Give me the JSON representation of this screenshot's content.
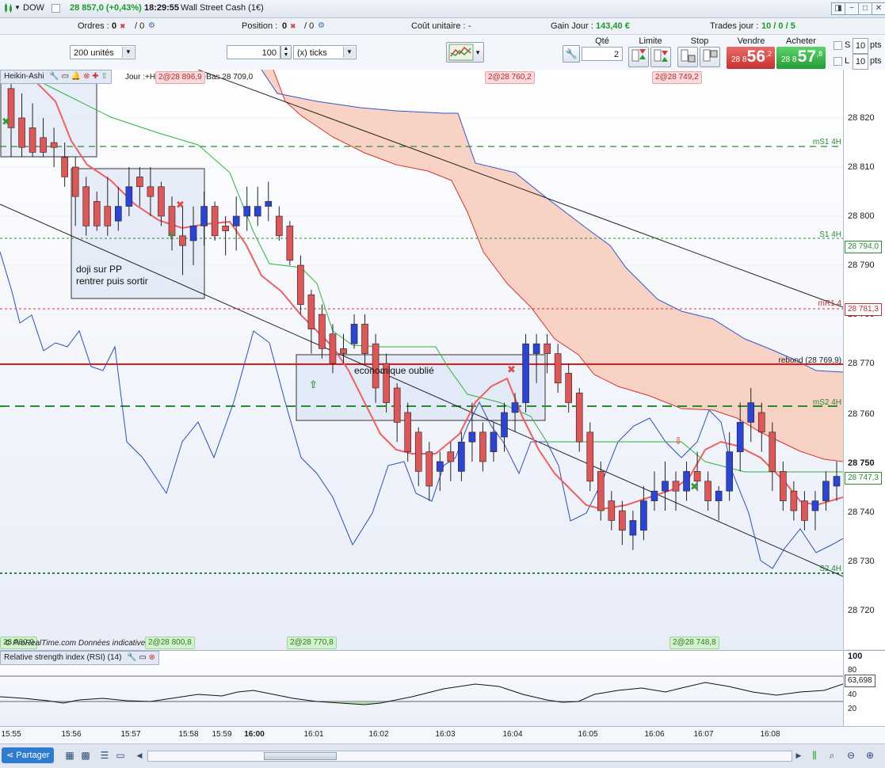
{
  "topbar": {
    "symbol": "DOW",
    "change": "28 857,0 (+0,43%)",
    "time": "18:29:55",
    "instrument": "Wall Street Cash (1€)"
  },
  "infobar": {
    "orders_label": "Ordres :",
    "orders_value": "0",
    "orders_value2": "/ 0",
    "position_label": "Position :",
    "position_value": "0",
    "position_value2": "/ 0",
    "unit_cost_label": "Coût unitaire :",
    "unit_cost_value": "-",
    "day_gain_label": "Gain Jour :",
    "day_gain_value": "143,40 €",
    "day_trades_label": "Trades jour :",
    "day_trades_value": "10 / 0 / 5"
  },
  "orderbar": {
    "units_select": "200 unités",
    "ticks_value": "100",
    "ticks_select": "(x) ticks",
    "qty_label": "Qté",
    "qty_value": "2",
    "limit_label": "Limite",
    "stop_label": "Stop",
    "sell_label": "Vendre",
    "sell_prefix": "28 8",
    "sell_big": "56",
    "sell_sup": ",2",
    "buy_label": "Acheter",
    "buy_prefix": "28 8",
    "buy_big": "57",
    "buy_sup": ",8",
    "s_label": "S",
    "s_pts": "10",
    "l_label": "L",
    "l_pts": "10",
    "pts_label": "pts"
  },
  "chart": {
    "indicator_title": "Heikin-Ashi",
    "legend_text": "Jour :+Haut 28 896,9 +Bas 28 709,0",
    "top_tags": [
      "2@28 896,9",
      "2@28 760,2",
      "2@28 749,2"
    ],
    "bottom_tags": [
      "2@28 800,8",
      "2@28 770,8",
      "2@28 748,8"
    ],
    "left_bottom_tag": "28 830,0",
    "copyright": "© ProRealTime.com  Données indicatives",
    "annotation_doji_line1": "doji sur PP",
    "annotation_doji_line2": "rentrer puis sortir",
    "annotation_eco": "economique oublié",
    "levels": {
      "ms1": "mS1 4H",
      "s1": "S1 4H",
      "mr1": "mR1 4",
      "ms2": "mS2 4H",
      "s2": "S2 4H",
      "rebond": "rebond (28 769,9)"
    },
    "price_axis_labels": [
      "28 820",
      "28 810",
      "28 800",
      "28 790",
      "28 780",
      "28 770",
      "28 760",
      "28 750",
      "28 740",
      "28 730",
      "28 720"
    ],
    "price_tags": {
      "s1_val": "28 794,0",
      "mr1_val": "28 781,3",
      "last_val": "28 747,3"
    }
  },
  "rsi": {
    "title": "Relative strength index (RSI) (14)",
    "axis_labels": [
      "100",
      "80",
      "40",
      "20"
    ],
    "value_tag": "63,698"
  },
  "time_axis": [
    "15:55",
    "15:56",
    "15:57",
    "15:58",
    "15:59",
    "16:00",
    "16:01",
    "16:02",
    "16:03",
    "16:04",
    "16:05",
    "16:06",
    "16:07",
    "16:08"
  ],
  "bottombar": {
    "share_label": "Partager"
  },
  "chart_data": {
    "type": "candlestick",
    "title": "",
    "ylim": [
      28715,
      28830
    ],
    "candles": [
      [
        28826,
        28828,
        28812,
        28818,
        "d"
      ],
      [
        28820,
        28825,
        28812,
        28814,
        "d"
      ],
      [
        28818,
        28823,
        28812,
        28813,
        "d"
      ],
      [
        28816,
        28820,
        28812,
        28813,
        "d"
      ],
      [
        28815,
        28818,
        28810,
        28814,
        "d"
      ],
      [
        28812,
        28815,
        28806,
        28808,
        "d"
      ],
      [
        28810,
        28812,
        28798,
        28804,
        "d"
      ],
      [
        28806,
        28808,
        28796,
        28798,
        "d"
      ],
      [
        28803,
        28805,
        28797,
        28798,
        "d"
      ],
      [
        28802,
        28808,
        28796,
        28798,
        "d"
      ],
      [
        28799,
        28806,
        28797,
        28802,
        "u"
      ],
      [
        28802,
        28810,
        28800,
        28806,
        "u"
      ],
      [
        28808,
        28810,
        28802,
        28806,
        "d"
      ],
      [
        28806,
        28810,
        28800,
        28804,
        "d"
      ],
      [
        28806,
        28807,
        28798,
        28800,
        "d"
      ],
      [
        28802,
        28804,
        28793,
        28796,
        "d"
      ],
      [
        28796,
        28802,
        28788,
        28794,
        "d"
      ],
      [
        28795,
        28802,
        28790,
        28798,
        "u"
      ],
      [
        28798,
        28805,
        28794,
        28802,
        "u"
      ],
      [
        28802,
        28803,
        28795,
        28796,
        "d"
      ],
      [
        28798,
        28800,
        28792,
        28797,
        "d"
      ],
      [
        28798,
        28804,
        28793,
        28800,
        "u"
      ],
      [
        28800,
        28806,
        28797,
        28802,
        "u"
      ],
      [
        28800,
        28806,
        28798,
        28802,
        "u"
      ],
      [
        28802,
        28807,
        28799,
        28803,
        "u"
      ],
      [
        28800,
        28802,
        28795,
        28796,
        "d"
      ],
      [
        28798,
        28799,
        28790,
        28791,
        "d"
      ],
      [
        28790,
        28792,
        28780,
        28782,
        "d"
      ],
      [
        28784,
        28785,
        28772,
        28777,
        "d"
      ],
      [
        28780,
        28782,
        28771,
        28773,
        "d"
      ],
      [
        28776,
        28778,
        28768,
        28770,
        "d"
      ],
      [
        28773,
        28776,
        28770,
        28772,
        "d"
      ],
      [
        28774,
        28780,
        28773,
        28778,
        "u"
      ],
      [
        28778,
        28780,
        28770,
        28772,
        "d"
      ],
      [
        28774,
        28776,
        28762,
        28765,
        "d"
      ],
      [
        28770,
        28772,
        28760,
        28762,
        "d"
      ],
      [
        28765,
        28766,
        28754,
        28758,
        "d"
      ],
      [
        28760,
        28762,
        28750,
        28752,
        "d"
      ],
      [
        28756,
        28757,
        28745,
        28748,
        "d"
      ],
      [
        28752,
        28754,
        28742,
        28745,
        "d"
      ],
      [
        28748,
        28752,
        28744,
        28750,
        "u"
      ],
      [
        28752,
        28754,
        28746,
        28750,
        "d"
      ],
      [
        28748,
        28756,
        28746,
        28754,
        "u"
      ],
      [
        28754,
        28762,
        28750,
        28756,
        "u"
      ],
      [
        28756,
        28758,
        28748,
        28750,
        "d"
      ],
      [
        28752,
        28758,
        28750,
        28756,
        "u"
      ],
      [
        28755,
        28762,
        28752,
        28760,
        "u"
      ],
      [
        28760,
        28764,
        28756,
        28762,
        "u"
      ],
      [
        28762,
        28776,
        28760,
        28774,
        "u"
      ],
      [
        28772,
        28776,
        28766,
        28774,
        "u"
      ],
      [
        28774,
        28776,
        28768,
        28772,
        "d"
      ],
      [
        28772,
        28774,
        28764,
        28766,
        "d"
      ],
      [
        28768,
        28770,
        28760,
        28762,
        "d"
      ],
      [
        28764,
        28765,
        28752,
        28754,
        "d"
      ],
      [
        28756,
        28758,
        28744,
        28746,
        "d"
      ],
      [
        28748,
        28750,
        28738,
        28740,
        "d"
      ],
      [
        28742,
        28744,
        28736,
        28738,
        "d"
      ],
      [
        28740,
        28742,
        28733,
        28736,
        "d"
      ],
      [
        28738,
        28740,
        28732,
        28735,
        "u"
      ],
      [
        28736,
        28745,
        28734,
        28742,
        "u"
      ],
      [
        28742,
        28748,
        28740,
        28744,
        "u"
      ],
      [
        28744,
        28750,
        28740,
        28746,
        "u"
      ],
      [
        28746,
        28748,
        28740,
        28744,
        "d"
      ],
      [
        28744,
        28750,
        28742,
        28748,
        "u"
      ],
      [
        28748,
        28752,
        28744,
        28746,
        "d"
      ],
      [
        28746,
        28748,
        28740,
        28742,
        "d"
      ],
      [
        28742,
        28745,
        28738,
        28744,
        "u"
      ],
      [
        28744,
        28756,
        28742,
        28752,
        "u"
      ],
      [
        28752,
        28762,
        28748,
        28758,
        "u"
      ],
      [
        28758,
        28765,
        28754,
        28762,
        "u"
      ],
      [
        28760,
        28762,
        28752,
        28756,
        "d"
      ],
      [
        28756,
        28758,
        28744,
        28748,
        "d"
      ],
      [
        28748,
        28750,
        28740,
        28742,
        "d"
      ],
      [
        28744,
        28746,
        28738,
        28740,
        "d"
      ],
      [
        28742,
        28744,
        28736,
        28738,
        "d"
      ],
      [
        28740,
        28744,
        28736,
        28742,
        "u"
      ],
      [
        28742,
        28748,
        28740,
        28746,
        "u"
      ],
      [
        28745,
        28750,
        28742,
        28747,
        "u"
      ]
    ]
  }
}
